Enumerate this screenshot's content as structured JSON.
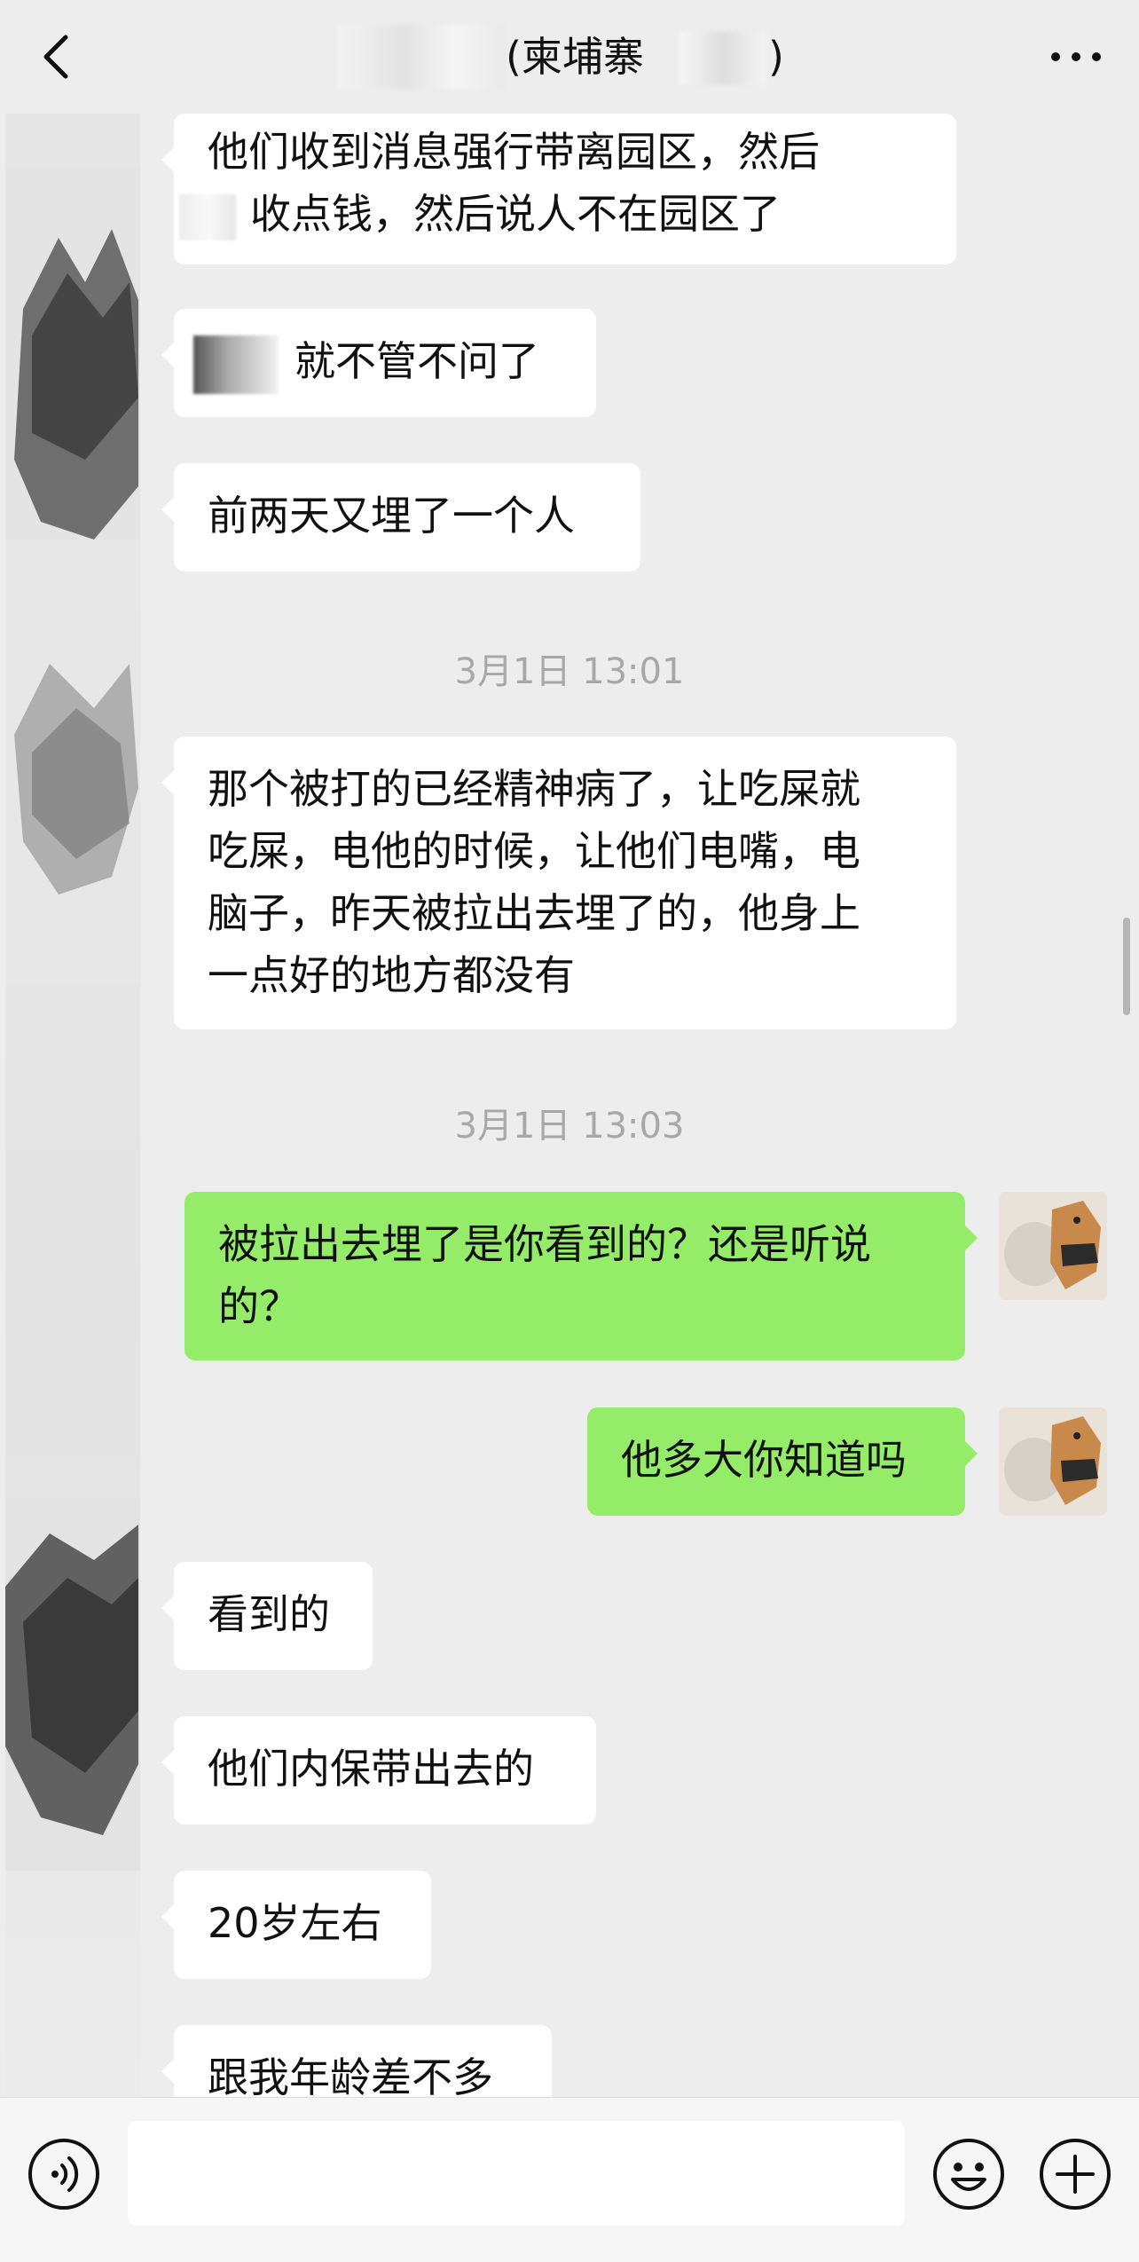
{
  "header": {
    "title": "(柬埔寨",
    "title_tail": ")",
    "back_icon": "chevron-left-icon",
    "more_icon": "more-dots-icon"
  },
  "messages": {
    "m1": {
      "lines": [
        "他们收到消息强行带离园区，然后",
        "收点钱，然后说人不在园区了"
      ]
    },
    "m2": {
      "text": "就不管不问了"
    },
    "m3": {
      "text": "前两天又埋了一个人"
    },
    "ts1": "3月1日 13:01",
    "m4": {
      "lines": [
        "那个被打的已经精神病了，让吃屎就",
        "吃屎，电他的时候，让他们电嘴，电",
        "脑子，昨天被拉出去埋了的，他身上",
        "一点好的地方都没有"
      ]
    },
    "ts2": "3月1日 13:03",
    "m5": {
      "lines": [
        "被拉出去埋了是你看到的？还是听说",
        "的？"
      ]
    },
    "m6": {
      "text": "他多大你知道吗"
    },
    "m7": {
      "text": "看到的"
    },
    "m8": {
      "text": "他们内保带出去的"
    },
    "m9": {
      "text": "20岁左右"
    },
    "m10": {
      "text": "跟我年龄差不多"
    }
  },
  "input_bar": {
    "placeholder": "",
    "voice_icon": "voice-icon",
    "emoji_icon": "emoji-icon",
    "plus_icon": "plus-icon"
  },
  "colors": {
    "background": "#ededed",
    "incoming_bubble": "#ffffff",
    "outgoing_bubble": "#95ec69",
    "timestamp": "#a8a8a8"
  }
}
